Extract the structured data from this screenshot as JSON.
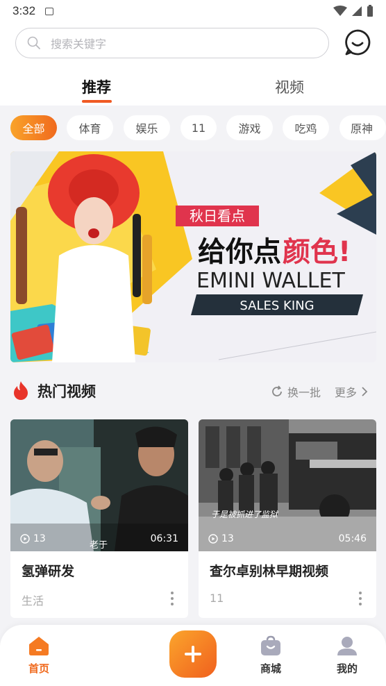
{
  "status_bar": {
    "time": "3:32"
  },
  "search": {
    "placeholder": "搜索关键字"
  },
  "tabs": [
    {
      "label": "推荐",
      "active": true
    },
    {
      "label": "视频",
      "active": false
    }
  ],
  "categories": [
    {
      "label": "全部",
      "active": true
    },
    {
      "label": "体育",
      "active": false
    },
    {
      "label": "娱乐",
      "active": false
    },
    {
      "label": "11",
      "active": false
    },
    {
      "label": "游戏",
      "active": false
    },
    {
      "label": "吃鸡",
      "active": false
    },
    {
      "label": "原神",
      "active": false
    }
  ],
  "banner": {
    "tag": "秋日看点",
    "headline_part1": "给你点",
    "headline_part2": "颜色!",
    "brand": "EMINI WALLET",
    "slogan": "SALES KING"
  },
  "hot_section": {
    "title": "热门视频",
    "refresh_label": "换一批",
    "more_label": "更多"
  },
  "videos": [
    {
      "title": "氢弹研发",
      "category": "生活",
      "views": "13",
      "duration": "06:31",
      "caption": "老于"
    },
    {
      "title": "查尔卓别林早期视频",
      "category": "11",
      "views": "13",
      "duration": "05:46",
      "caption": "于是被抓进了监狱"
    }
  ],
  "bottom_nav": {
    "home": "首页",
    "shop": "商城",
    "mine": "我的"
  },
  "colors": {
    "accent": "#f06a1e",
    "accent_light": "#f9a32a"
  }
}
